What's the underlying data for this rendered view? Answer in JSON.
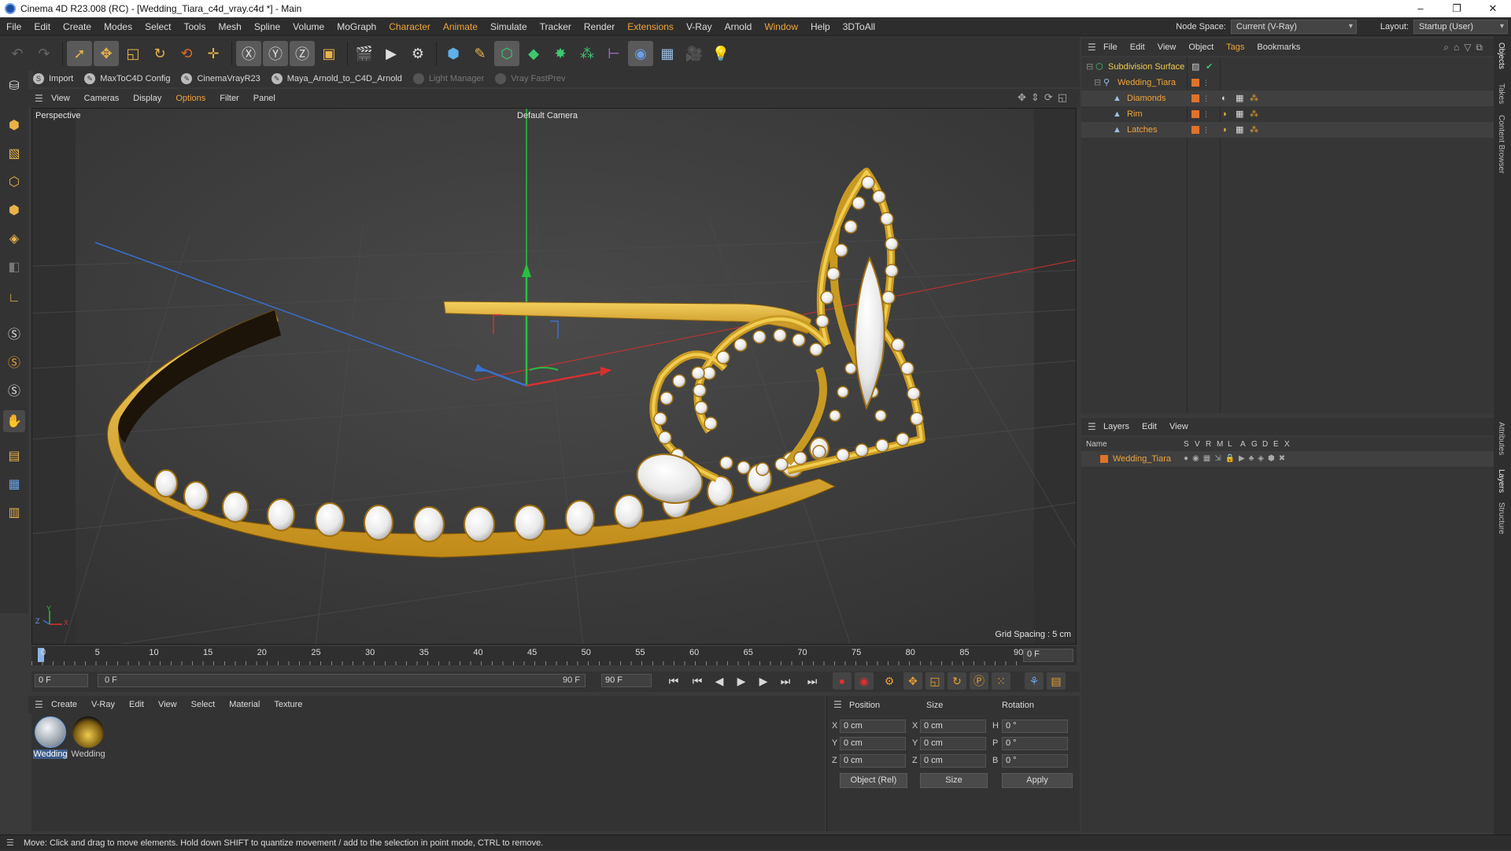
{
  "window": {
    "title": "Cinema 4D R23.008 (RC) - [Wedding_Tiara_c4d_vray.c4d *] - Main",
    "controls": [
      "–",
      "❐",
      "✕"
    ]
  },
  "menubar": {
    "items": [
      "File",
      "Edit",
      "Create",
      "Modes",
      "Select",
      "Tools",
      "Mesh",
      "Spline",
      "Volume",
      "MoGraph",
      "Character",
      "Animate",
      "Simulate",
      "Tracker",
      "Render",
      "Extensions",
      "V-Ray",
      "Arnold",
      "Window",
      "Help",
      "3DToAll"
    ],
    "node_space_label": "Node Space:",
    "node_space_value": "Current (V-Ray)",
    "layout_label": "Layout:",
    "layout_value": "Startup (User)"
  },
  "pluginbar": {
    "items": [
      "Import",
      "MaxToC4D Config",
      "CinemaVrayR23",
      "Maya_Arnold_to_C4D_Arnold",
      "Light Manager",
      "Vray FastPrev"
    ]
  },
  "viewport": {
    "menu": [
      "View",
      "Cameras",
      "Display",
      "Options",
      "Filter",
      "Panel"
    ],
    "view_name": "Perspective",
    "camera": "Default Camera",
    "grid_spacing": "Grid Spacing : 5 cm",
    "axis_y": "Y",
    "axis_x": "X",
    "axis_z": "Z"
  },
  "timeline": {
    "ticks": [
      "0",
      "5",
      "10",
      "15",
      "20",
      "25",
      "30",
      "35",
      "40",
      "45",
      "50",
      "55",
      "60",
      "65",
      "70",
      "75",
      "80",
      "85",
      "90"
    ],
    "current_frame": "0 F",
    "start_frame": "0 F",
    "range_start": "0 F",
    "range_end": "90 F",
    "end_frame": "90 F"
  },
  "materials": {
    "menu": [
      "Create",
      "V-Ray",
      "Edit",
      "View",
      "Select",
      "Material",
      "Texture"
    ],
    "items": [
      {
        "label": "Wedding",
        "color": "#9aa4b0"
      },
      {
        "label": "Wedding",
        "color": "#c8a230"
      }
    ]
  },
  "coordinates": {
    "headers": [
      "Position",
      "Size",
      "Rotation"
    ],
    "rows": [
      {
        "axis": "X",
        "pos": "0 cm",
        "size_axis": "X",
        "size": "0 cm",
        "rot_axis": "H",
        "rot": "0 °"
      },
      {
        "axis": "Y",
        "pos": "0 cm",
        "size_axis": "Y",
        "size": "0 cm",
        "rot_axis": "P",
        "rot": "0 °"
      },
      {
        "axis": "Z",
        "pos": "0 cm",
        "size_axis": "Z",
        "size": "0 cm",
        "rot_axis": "B",
        "rot": "0 °"
      }
    ],
    "mode_select": "Object (Rel)",
    "size_select": "Size",
    "apply_label": "Apply"
  },
  "object_manager": {
    "menu": [
      "File",
      "Edit",
      "View",
      "Object",
      "Tags",
      "Bookmarks"
    ],
    "objects": [
      {
        "name": "Subdivision Surface"
      },
      {
        "name": "Wedding_Tiara"
      },
      {
        "name": "Diamonds"
      },
      {
        "name": "Rim"
      },
      {
        "name": "Latches"
      }
    ]
  },
  "layer_manager": {
    "menu": [
      "Layers",
      "Edit",
      "View"
    ],
    "columns": [
      "Name",
      "S",
      "V",
      "R",
      "M",
      "L",
      "A",
      "G",
      "D",
      "E",
      "X"
    ],
    "layers": [
      {
        "name": "Wedding_Tiara",
        "color": "#e0722a"
      }
    ]
  },
  "right_tabs": [
    "Objects",
    "Takes",
    "Content Browser",
    "Attributes",
    "Layers",
    "Structure"
  ],
  "status": "Move: Click and drag to move elements. Hold down SHIFT to quantize movement / add to the selection in point mode, CTRL to remove.",
  "colors": {
    "accent": "#f0a53a",
    "layer_orange": "#e0722a",
    "gold": "#e2b93b",
    "axis_x": "#d83030",
    "axis_y": "#28c040",
    "axis_z": "#3a70d0"
  }
}
